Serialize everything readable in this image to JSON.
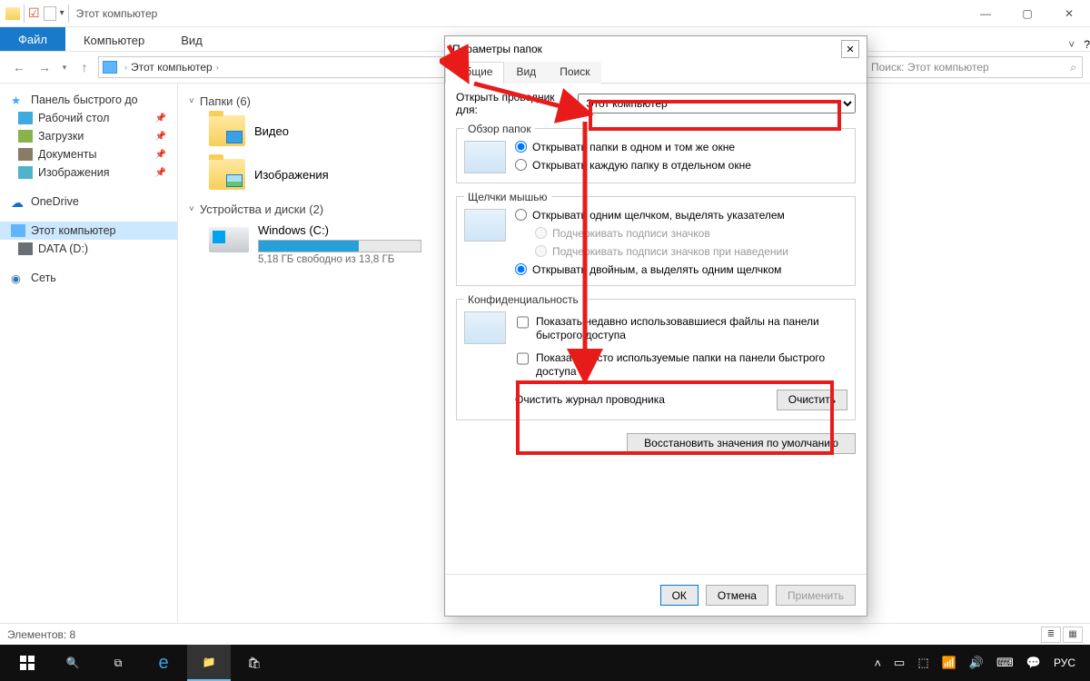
{
  "title": "Этот компьютер",
  "ribbon": {
    "file": "Файл",
    "computer": "Компьютер",
    "view": "Вид"
  },
  "breadcrumb": "Этот компьютер",
  "search_placeholder": "Поиск: Этот компьютер",
  "sidebar": {
    "quick": "Панель быстрого до",
    "desktop": "Рабочий стол",
    "downloads": "Загрузки",
    "documents": "Документы",
    "images": "Изображения",
    "onedrive": "OneDrive",
    "thispc": "Этот компьютер",
    "data": "DATA (D:)",
    "network": "Сеть"
  },
  "content": {
    "folders_head": "Папки (6)",
    "video": "Видео",
    "pictures": "Изображения",
    "devices_head": "Устройства и диски (2)",
    "drive_name": "Windows (C:)",
    "drive_free": "5,18 ГБ свободно из 13,8 ГБ",
    "drive_fill_pct": 62
  },
  "statusbar": {
    "items": "Элементов: 8"
  },
  "taskbar": {
    "lang": "РУС"
  },
  "dialog": {
    "title": "Параметры папок",
    "tabs": {
      "general": "Общие",
      "view": "Вид",
      "search": "Поиск"
    },
    "open_label": "Открыть проводник для:",
    "open_value": "Этот компьютер",
    "group_browse": "Обзор папок",
    "browse_same": "Открывать папки в одном и том же окне",
    "browse_new": "Открывать каждую папку в отдельном окне",
    "group_click": "Щелчки мышью",
    "click_single": "Открывать одним щелчком, выделять указателем",
    "click_underline_icon": "Подчеркивать подписи значков",
    "click_underline_hover": "Подчеркивать подписи значков при наведении",
    "click_double": "Открывать двойным, а выделять одним щелчком",
    "group_privacy": "Конфиденциальность",
    "privacy_files": "Показать недавно использовавшиеся файлы на панели быстрого доступа",
    "privacy_folders": "Показать часто используемые папки на панели быстрого доступа",
    "clear_label": "Очистить журнал проводника",
    "clear_btn": "Очистить",
    "restore": "Восстановить значения по умолчанию",
    "ok": "ОК",
    "cancel": "Отмена",
    "apply": "Применить"
  }
}
